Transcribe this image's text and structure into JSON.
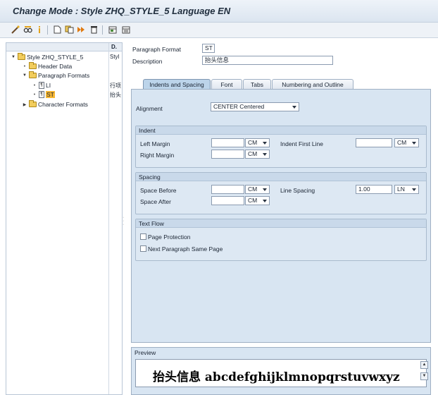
{
  "title": "Change Mode : Style ZHQ_STYLE_5 Language EN",
  "toolbar": {
    "icons": [
      "wand-icon",
      "glasses-icon",
      "info-icon",
      "new-page-icon",
      "copy-icon",
      "forward-icon",
      "delete-icon",
      "grid-select-icon",
      "grid-deselect-icon"
    ]
  },
  "tree": {
    "col_header": "D.",
    "root": "Style ZHQ_STYLE_5",
    "root_desc": "Styl",
    "header_data": "Header Data",
    "paragraph_formats": "Paragraph Formats",
    "li": {
      "name": "LI",
      "desc": "行项"
    },
    "st": {
      "name": "ST",
      "desc": "抬头"
    },
    "character_formats": "Character Formats"
  },
  "form": {
    "paragraph_format_label": "Paragraph Format",
    "paragraph_format_value": "ST",
    "description_label": "Description",
    "description_value": "抬头信息"
  },
  "tabs": [
    "Indents and Spacing",
    "Font",
    "Tabs",
    "Numbering and Outline"
  ],
  "alignment": {
    "label": "Alignment",
    "value": "CENTER Centered"
  },
  "indent": {
    "title": "Indent",
    "left_margin": "Left Margin",
    "right_margin": "Right Margin",
    "indent_first_line": "Indent First Line",
    "left_unit": "CM",
    "right_unit": "CM",
    "first_unit": "CM"
  },
  "spacing": {
    "title": "Spacing",
    "space_before": "Space Before",
    "space_after": "Space After",
    "line_spacing": "Line Spacing",
    "before_unit": "CM",
    "after_unit": "CM",
    "line_value": "1.00",
    "line_unit": "LN"
  },
  "text_flow": {
    "title": "Text Flow",
    "page_protection": "Page Protection",
    "next_same_page": "Next Paragraph Same Page"
  },
  "preview": {
    "title": "Preview",
    "text": "抬头信息  abcdefghijklmnopqrstuvwxyz"
  }
}
